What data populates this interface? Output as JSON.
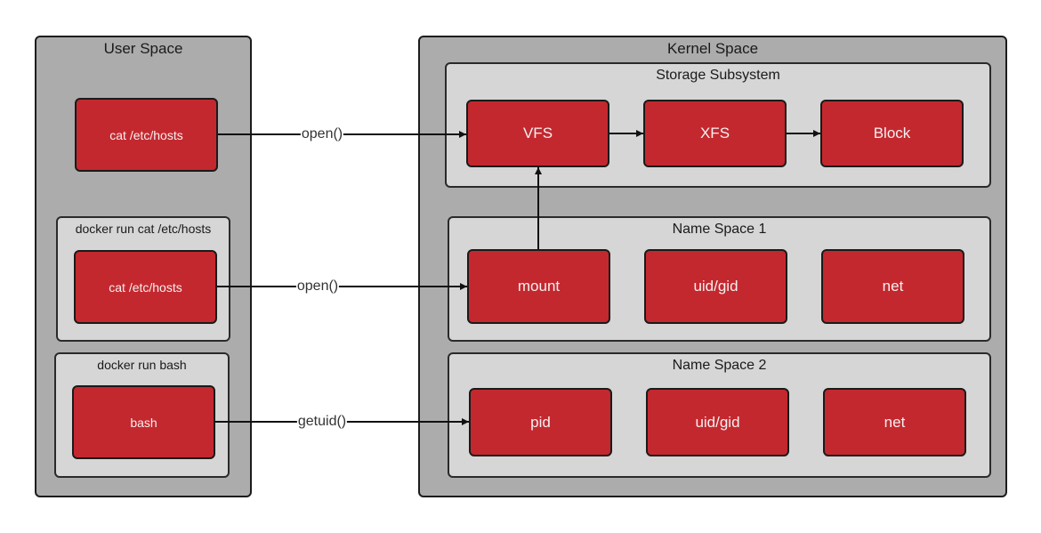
{
  "user_space": {
    "title": "User Space",
    "process": "cat /etc/hosts",
    "containers": [
      {
        "title": "docker run cat /etc/hosts",
        "process": "cat /etc/hosts"
      },
      {
        "title": "docker run bash",
        "process": "bash"
      }
    ]
  },
  "kernel_space": {
    "title": "Kernel Space",
    "storage": {
      "title": "Storage Subsystem",
      "nodes": [
        "VFS",
        "XFS",
        "Block"
      ]
    },
    "namespaces": [
      {
        "title": "Name Space 1",
        "nodes": [
          "mount",
          "uid/gid",
          "net"
        ]
      },
      {
        "title": "Name Space 2",
        "nodes": [
          "pid",
          "uid/gid",
          "net"
        ]
      }
    ]
  },
  "edges": [
    {
      "from": "cat /etc/hosts",
      "to": "VFS",
      "label": "open()"
    },
    {
      "from": "docker run cat /etc/hosts / cat /etc/hosts",
      "to": "mount",
      "label": "open()"
    },
    {
      "from": "docker run bash / bash",
      "to": "pid",
      "label": "getuid()"
    },
    {
      "from": "mount",
      "to": "VFS",
      "label": ""
    },
    {
      "from": "VFS",
      "to": "XFS",
      "label": ""
    },
    {
      "from": "XFS",
      "to": "Block",
      "label": ""
    }
  ],
  "colors": {
    "outer_fill": "#acacac",
    "inner_fill": "#d6d6d6",
    "node_fill": "#c4282f",
    "node_text": "#f5f0f0",
    "stroke": "#1a1a1a"
  }
}
